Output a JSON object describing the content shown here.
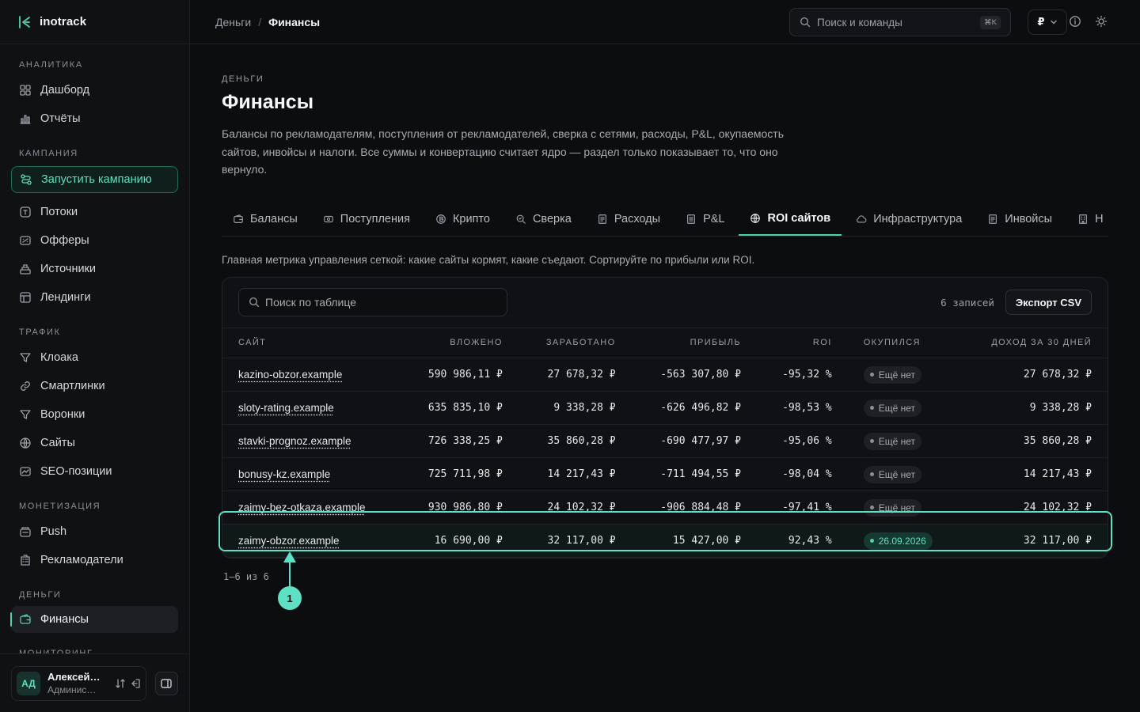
{
  "brand": {
    "name": "inotrack"
  },
  "sidebar": {
    "sections": [
      {
        "title": "АНАЛИТИКА",
        "items": [
          {
            "label": "Дашборд",
            "icon": "grid-icon"
          },
          {
            "label": "Отчёты",
            "icon": "bar-chart-icon"
          }
        ]
      },
      {
        "title": "КАМПАНИЯ",
        "cta": {
          "label": "Запустить кампанию",
          "icon": "route-icon"
        },
        "items": [
          {
            "label": "Потоки",
            "icon": "flow-icon"
          },
          {
            "label": "Офферы",
            "icon": "offer-icon"
          },
          {
            "label": "Источники",
            "icon": "sources-icon"
          },
          {
            "label": "Лендинги",
            "icon": "landing-icon"
          }
        ]
      },
      {
        "title": "ТРАФИК",
        "items": [
          {
            "label": "Клоака",
            "icon": "filter-icon"
          },
          {
            "label": "Смартлинки",
            "icon": "link-icon"
          },
          {
            "label": "Воронки",
            "icon": "funnel-icon"
          },
          {
            "label": "Сайты",
            "icon": "globe-icon"
          },
          {
            "label": "SEO-позиции",
            "icon": "seo-icon"
          }
        ]
      },
      {
        "title": "МОНЕТИЗАЦИЯ",
        "items": [
          {
            "label": "Push",
            "icon": "push-icon"
          },
          {
            "label": "Рекламодатели",
            "icon": "building-icon"
          }
        ]
      },
      {
        "title": "ДЕНЬГИ",
        "items": [
          {
            "label": "Финансы",
            "icon": "wallet-icon",
            "active": true
          }
        ]
      },
      {
        "title": "МОНИТОРИНГ",
        "items": []
      }
    ],
    "user": {
      "initials": "АД",
      "name": "Алексей…",
      "role": "Админис…"
    }
  },
  "topbar": {
    "breadcrumb": [
      "Деньги",
      "Финансы"
    ],
    "search_placeholder": "Поиск и команды",
    "shortcut": "⌘K",
    "currency": "₽"
  },
  "page": {
    "eyebrow": "ДЕНЬГИ",
    "title": "Финансы",
    "description": "Балансы по рекламодателям, поступления от рекламодателей, сверка с сетями, расходы, P&L, окупаемость сайтов, инвойсы и налоги. Все суммы и конвертацию считает ядро — раздел только показывает то, что оно вернуло.",
    "tabs": [
      {
        "label": "Балансы",
        "icon": "wallet-icon"
      },
      {
        "label": "Поступления",
        "icon": "cash-icon"
      },
      {
        "label": "Крипто",
        "icon": "coin-icon"
      },
      {
        "label": "Сверка",
        "icon": "reconcile-icon"
      },
      {
        "label": "Расходы",
        "icon": "receipt-icon"
      },
      {
        "label": "P&L",
        "icon": "report-icon"
      },
      {
        "label": "ROI сайтов",
        "icon": "globe-icon",
        "active": true
      },
      {
        "label": "Инфраструктура",
        "icon": "cloud-icon"
      },
      {
        "label": "Инвойсы",
        "icon": "invoice-icon"
      },
      {
        "label": "Н",
        "icon": "tax-icon"
      }
    ],
    "hint": "Главная метрика управления сеткой: какие сайты кормят, какие съедают. Сортируйте по прибыли или ROI."
  },
  "table": {
    "search_placeholder": "Поиск по таблице",
    "count": "6 записей",
    "export_label": "Экспорт CSV",
    "columns": [
      "САЙТ",
      "ВЛОЖЕНО",
      "ЗАРАБОТАНО",
      "ПРИБЫЛЬ",
      "ROI",
      "ОКУПИЛСЯ",
      "ДОХОД ЗА 30 ДНЕЙ"
    ],
    "rows": [
      {
        "site": "kazino-obzor.example",
        "invested": "590 986,11 ₽",
        "earned": "27 678,32 ₽",
        "profit": "-563 307,80 ₽",
        "roi": "-95,32 %",
        "payback": "Ещё нет",
        "paid": false,
        "income30": "27 678,32 ₽"
      },
      {
        "site": "sloty-rating.example",
        "invested": "635 835,10 ₽",
        "earned": "9 338,28 ₽",
        "profit": "-626 496,82 ₽",
        "roi": "-98,53 %",
        "payback": "Ещё нет",
        "paid": false,
        "income30": "9 338,28 ₽"
      },
      {
        "site": "stavki-prognoz.example",
        "invested": "726 338,25 ₽",
        "earned": "35 860,28 ₽",
        "profit": "-690 477,97 ₽",
        "roi": "-95,06 %",
        "payback": "Ещё нет",
        "paid": false,
        "income30": "35 860,28 ₽"
      },
      {
        "site": "bonusy-kz.example",
        "invested": "725 711,98 ₽",
        "earned": "14 217,43 ₽",
        "profit": "-711 494,55 ₽",
        "roi": "-98,04 %",
        "payback": "Ещё нет",
        "paid": false,
        "income30": "14 217,43 ₽"
      },
      {
        "site": "zaimy-bez-otkaza.example",
        "invested": "930 986,80 ₽",
        "earned": "24 102,32 ₽",
        "profit": "-906 884,48 ₽",
        "roi": "-97,41 %",
        "payback": "Ещё нет",
        "paid": false,
        "income30": "24 102,32 ₽"
      },
      {
        "site": "zaimy-obzor.example",
        "invested": "16 690,00 ₽",
        "earned": "32 117,00 ₽",
        "profit": "15 427,00 ₽",
        "roi": "92,43 %",
        "payback": "26.09.2026",
        "paid": true,
        "income30": "32 117,00 ₽",
        "highlighted": true
      }
    ],
    "pager": "1–6 из 6"
  },
  "annotation": {
    "marker": "1"
  },
  "colors": {
    "accent": "#4fd1b0",
    "highlight": "#5ee0c4",
    "background": "#0c0d0f"
  }
}
